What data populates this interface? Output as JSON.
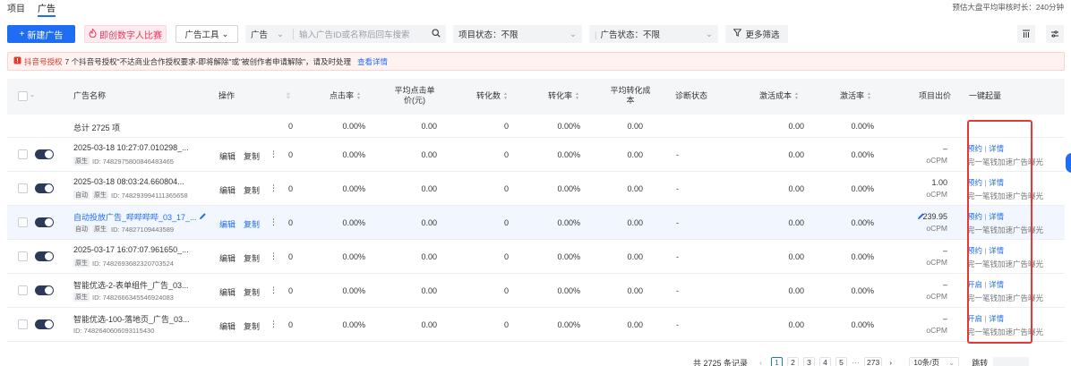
{
  "tabs": [
    {
      "label": "项目"
    },
    {
      "label": "广告"
    }
  ],
  "review_time": "预估大盘平均审核时长：240分钟",
  "toolbar": {
    "new_ad": "新建广告",
    "digital_compare": "即创数字人比赛",
    "ad_tools": "广告工具",
    "search_type": "广告",
    "search_placeholder": "输入广告ID或名称后回车搜索",
    "project_status_label": "项目状态：",
    "project_status_value": "不限",
    "ad_status_label": "广告状态：",
    "ad_status_value": "不限",
    "more_filter": "更多筛选"
  },
  "alert": {
    "tag": "抖音号授权",
    "text": "7 个抖音号授权\"不达商业合作授权要求-即将解除\"或\"被创作者申请解除\"，请及时处理",
    "link": "查看详情"
  },
  "columns": {
    "name": "广告名称",
    "ops": "操作",
    "click_rate": "点击率",
    "avg_cpc_1": "平均点击单",
    "avg_cpc_2": "价(元)",
    "conversions": "转化数",
    "conv_rate": "转化率",
    "avg_conv_cost_1": "平均转化成",
    "avg_conv_cost_2": "本",
    "diagnosis": "诊断状态",
    "activation_cost": "激活成本",
    "activation_rate": "激活率",
    "bid": "项目出价",
    "boost": "一键起量"
  },
  "total": {
    "label": "总计 2725 项",
    "zero": "0",
    "click_rate": "0.00%",
    "avg_cpc": "0.00",
    "conversions": "0",
    "conv_rate": "0.00%",
    "avg_conv_cost": "0.00",
    "activation_cost": "0.00",
    "activation_rate": "0.00%"
  },
  "ops": {
    "edit": "编辑",
    "copy": "复制",
    "more": "⋮",
    "dash": "-",
    "bid_type": "oCPM",
    "detail": "详情",
    "sep": "|",
    "boost_tip": "完一笔钱加速广告曝光"
  },
  "rows": [
    {
      "name": "2025-03-18 10:27:07.010298_...",
      "badges": [
        "原生"
      ],
      "id": "ID: 7482975800846483465",
      "bid": "–",
      "boost_action": "预约",
      "zero": "0",
      "click_rate": "0.00%",
      "avg_cpc": "0.00",
      "conversions": "0",
      "conv_rate": "0.00%",
      "avg_conv_cost": "0.00",
      "activation_cost": "0.00",
      "activation_rate": "0.00%"
    },
    {
      "name": "2025-03-18 08:03:24.660804...",
      "badges": [
        "自动",
        "原生"
      ],
      "id": "ID: 748293994111365658",
      "bid": "1.00",
      "boost_action": "预约",
      "zero": "0",
      "click_rate": "0.00%",
      "avg_cpc": "0.00",
      "conversions": "0",
      "conv_rate": "0.00%",
      "avg_conv_cost": "0.00",
      "activation_cost": "0.00",
      "activation_rate": "0.00%"
    },
    {
      "name": "自动投放广告_哔哔哔哔_03_17_...",
      "badges": [
        "自动",
        "原生"
      ],
      "id": "ID: 74827109443589",
      "bid": "239.95",
      "boost_action": "预约",
      "zero": "0",
      "click_rate": "0.00%",
      "avg_cpc": "0.00",
      "conversions": "0",
      "conv_rate": "0.00%",
      "avg_conv_cost": "0.00",
      "activation_cost": "0.00",
      "activation_rate": "0.00%"
    },
    {
      "name": "2025-03-17 16:07:07.961650_...",
      "badges": [
        "原生"
      ],
      "id": "ID: 7482693682320703524",
      "bid": "–",
      "boost_action": "预约",
      "zero": "0",
      "click_rate": "0.00%",
      "avg_cpc": "0.00",
      "conversions": "0",
      "conv_rate": "0.00%",
      "avg_conv_cost": "0.00",
      "activation_cost": "0.00",
      "activation_rate": "0.00%"
    },
    {
      "name": "智能优选-2-表单组件_广告_03...",
      "badges": [
        "原生"
      ],
      "id": "ID: 7482666345546924083",
      "bid": "–",
      "boost_action": "开启",
      "zero": "0",
      "click_rate": "0.00%",
      "avg_cpc": "0.00",
      "conversions": "0",
      "conv_rate": "0.00%",
      "avg_conv_cost": "0.00",
      "activation_cost": "0.00",
      "activation_rate": "0.00%"
    },
    {
      "name": "智能优选-100-落地页_广告_03...",
      "badges": [],
      "id": "ID: 7482640606093115430",
      "bid": "–",
      "boost_action": "开启",
      "zero": "0",
      "click_rate": "0.00%",
      "avg_cpc": "0.00",
      "conversions": "0",
      "conv_rate": "0.00%",
      "avg_conv_cost": "0.00",
      "activation_cost": "0.00",
      "activation_rate": "0.00%"
    }
  ],
  "pagination": {
    "total": "共 2725 条记录",
    "pages": [
      "1",
      "2",
      "3",
      "4",
      "5"
    ],
    "ellipsis": "···",
    "last": "273",
    "page_size": "10条/页",
    "jump": "跳转",
    "prev": "‹",
    "next": "›"
  }
}
